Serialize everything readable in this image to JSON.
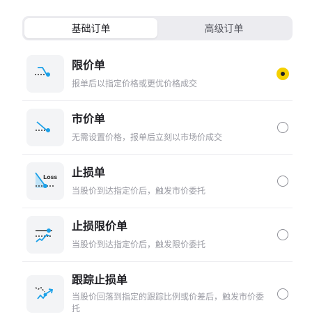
{
  "tabs": [
    {
      "label": "基础订单",
      "active": true
    },
    {
      "label": "高级订单",
      "active": false
    }
  ],
  "orders": [
    {
      "title": "限价单",
      "desc": "报单后以指定价格或更优价格成交",
      "selected": true,
      "icon": "limit-order-icon"
    },
    {
      "title": "市价单",
      "desc": "无需设置价格，报单后立刻以市场价成交",
      "selected": false,
      "icon": "market-order-icon"
    },
    {
      "title": "止损单",
      "desc": "当股价到达指定价后，触发市价委托",
      "selected": false,
      "icon": "stop-loss-icon",
      "icon_text": "Loss"
    },
    {
      "title": "止损限价单",
      "desc": "当股价到达指定价后，触发限价委托",
      "selected": false,
      "icon": "stop-limit-icon"
    },
    {
      "title": "跟踪止损单",
      "desc": "当股价回落到指定的跟踪比例或价差后，触发市价委托",
      "selected": false,
      "icon": "trailing-stop-icon"
    }
  ],
  "colors": {
    "accent": "#f5d000",
    "icon_blue": "#1aa0e8"
  }
}
